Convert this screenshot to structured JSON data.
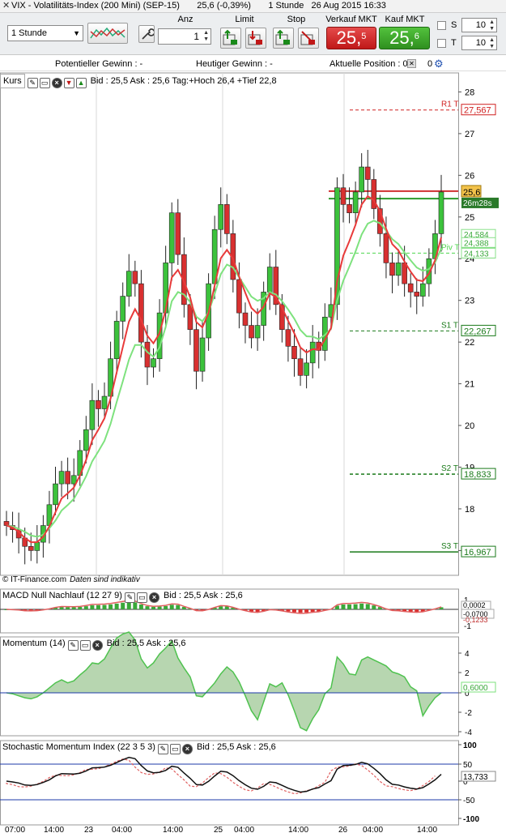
{
  "window": {
    "title": "VIX - Volatilitäts-Index (200 Mini) (SEP-15)",
    "price_change": "25,6 (-0,39%)",
    "interval": "1 Stunde",
    "datetime": "26 Aug 2015 16:33"
  },
  "toolbar": {
    "timeframe": "1 Stunde",
    "anz_label": "Anz",
    "quantity": "1",
    "limit_label": "Limit",
    "stop_label": "Stop",
    "sell_label": "Verkauf MKT",
    "buy_label": "Kauf MKT",
    "sell_price_main": "25,",
    "sell_price_sup": "5",
    "buy_price_main": "25,",
    "buy_price_sup": "6",
    "s_label": "S",
    "t_label": "T",
    "s_value": "10",
    "t_value": "10"
  },
  "info": {
    "potential_gain": "Potentieller Gewinn : -",
    "today_gain": "Heutiger Gewinn : -",
    "position": "Aktuelle Position : 0",
    "position_end": "0"
  },
  "price_panel": {
    "label": "Kurs",
    "header": "Bid : 25,5 Ask : 25,6 Tag:+Hoch 26,4 +Tief 22,8",
    "last_price": "25,6",
    "countdown": "26m28s",
    "ma_labels": [
      "24,584",
      "24,388",
      "24,133"
    ],
    "footnote_brand": "© IT-Finance.com",
    "footnote_text": "Daten sind indikativ",
    "pivots": [
      {
        "name": "R1 T",
        "value": "27,567",
        "color": "#d02020",
        "level": 27.567
      },
      {
        "name": "Piv T",
        "value": "24,133",
        "color": "#4fd64f",
        "level": 24.133
      },
      {
        "name": "S1 T",
        "value": "22,267",
        "color": "#1a7a1a",
        "level": 22.267
      },
      {
        "name": "S2 T",
        "value": "18,833",
        "color": "#1a7a1a",
        "level": 18.833
      },
      {
        "name": "S3 T",
        "value": "16,967",
        "color": "#1a7a1a",
        "level": 16.967
      }
    ]
  },
  "macd_panel": {
    "label": "MACD Null Nachlauf (12 27 9)",
    "header": "Bid : 25,5 Ask : 25,6",
    "value1": "0,0002",
    "value2": "-0,0700",
    "value3": "-0,1233"
  },
  "momentum_panel": {
    "label": "Momentum (14)",
    "header": "Bid : 25,5 Ask : 25,6",
    "value": "0,6000"
  },
  "stoch_panel": {
    "label": "Stochastic Momentum Index (22 3 5 3)",
    "header": "Bid : 25,5 Ask : 25,6",
    "value": "13,733"
  },
  "chart_data": {
    "type": "candlestick",
    "y_range": [
      16.6,
      28.3
    ],
    "y_ticks": [
      "28",
      "27",
      "26",
      "25",
      "24",
      "23",
      "22",
      "21",
      "20",
      "19",
      "18",
      "17"
    ],
    "macd_ticks": [
      "1",
      "0",
      "-1"
    ],
    "momentum_ticks": [
      "4",
      "2",
      "0",
      "-2",
      "-4"
    ],
    "stoch_ticks": [
      "100",
      "50",
      "0",
      "-50",
      "-100"
    ],
    "x_labels": [
      "07:00",
      "14:00",
      "23",
      "04:00",
      "14:00",
      "25",
      "04:00",
      "14:00",
      "26",
      "04:00",
      "14:00"
    ],
    "close": [
      17.6,
      17.5,
      17.3,
      17.1,
      17.0,
      17.2,
      17.6,
      18.1,
      18.6,
      18.9,
      18.6,
      18.8,
      19.4,
      19.9,
      20.6,
      20.4,
      20.7,
      21.6,
      22.5,
      23.1,
      23.7,
      23.4,
      22.0,
      21.4,
      21.6,
      22.7,
      23.9,
      25.1,
      24.1,
      22.9,
      22.3,
      21.3,
      22.1,
      23.4,
      24.7,
      25.3,
      24.6,
      23.5,
      22.7,
      22.4,
      22.1,
      22.4,
      23.2,
      23.8,
      22.9,
      22.3,
      21.9,
      21.6,
      21.2,
      21.5,
      22.0,
      21.8,
      22.6,
      22.9,
      25.7,
      25.3,
      25.1,
      25.6,
      26.2,
      25.9,
      25.2,
      24.6,
      23.9,
      23.6,
      23.9,
      23.4,
      23.2,
      23.1,
      23.4,
      24.0,
      24.6,
      25.6
    ],
    "ma_fast": [
      17.6,
      17.55,
      17.45,
      17.3,
      17.2,
      17.2,
      17.33,
      17.58,
      17.92,
      18.25,
      18.37,
      18.51,
      18.8,
      19.17,
      19.65,
      19.9,
      20.17,
      20.65,
      21.27,
      21.88,
      22.49,
      22.79,
      22.53,
      22.15,
      21.97,
      22.21,
      22.77,
      23.55,
      23.73,
      23.45,
      23.07,
      22.48,
      22.35,
      22.7,
      23.36,
      24.01,
      24.21,
      24.0,
      23.57,
      23.18,
      22.82,
      22.68,
      22.85,
      23.17,
      23.08,
      22.82,
      22.51,
      22.21,
      21.87,
      21.75,
      21.83,
      21.82,
      22.06,
      22.34,
      23.46,
      24.07,
      24.42,
      24.81,
      25.3,
      25.5,
      25.4,
      25.14,
      24.72,
      24.35,
      24.2,
      23.93,
      23.69,
      23.49,
      23.46,
      23.64,
      23.96,
      24.51
    ],
    "ma_slow": [
      17.6,
      17.58,
      17.52,
      17.45,
      17.36,
      17.33,
      17.38,
      17.53,
      17.72,
      17.96,
      18.09,
      18.24,
      18.5,
      18.78,
      19.14,
      19.38,
      19.63,
      20.04,
      20.56,
      21.06,
      21.58,
      21.93,
      21.93,
      21.76,
      21.65,
      21.87,
      22.36,
      22.98,
      23.2,
      23.14,
      22.96,
      22.61,
      22.5,
      22.71,
      23.16,
      23.63,
      23.86,
      23.79,
      23.55,
      23.32,
      23.09,
      22.99,
      23.05,
      23.2,
      23.14,
      22.98,
      22.78,
      22.56,
      22.29,
      22.14,
      22.13,
      22.07,
      22.17,
      22.32,
      23.0,
      23.47,
      23.81,
      24.17,
      24.58,
      24.84,
      24.91,
      24.85,
      24.67,
      24.47,
      24.35,
      24.15,
      23.96,
      23.79,
      23.71,
      23.75,
      23.91,
      24.25
    ]
  }
}
